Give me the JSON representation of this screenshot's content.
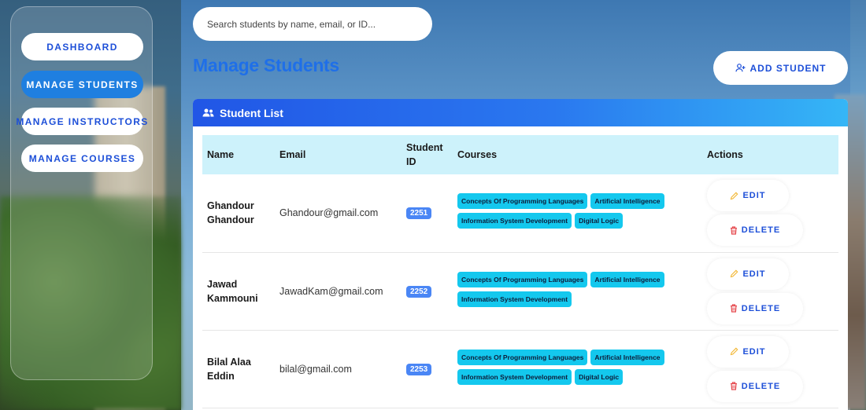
{
  "sidebar": {
    "items": [
      {
        "label": "DASHBOARD",
        "active": false
      },
      {
        "label": "MANAGE STUDENTS",
        "active": true
      },
      {
        "label": "MANAGE INSTRUCTORS",
        "active": false
      },
      {
        "label": "MANAGE COURSES",
        "active": false
      }
    ]
  },
  "search": {
    "placeholder": "Search students by name, email, or ID..."
  },
  "page": {
    "title": "Manage Students",
    "add_button_label": "ADD STUDENT"
  },
  "list": {
    "header": "Student List",
    "columns": [
      "Name",
      "Email",
      "Student ID",
      "Courses",
      "Actions"
    ],
    "edit_label": "EDIT",
    "delete_label": "DELETE",
    "rows": [
      {
        "name_line1": "Ghandour",
        "name_line2": "Ghandour",
        "email": "Ghandour@gmail.com",
        "id": "2251",
        "courses": [
          "Concepts Of Programming Languages",
          "Artificial Intelligence",
          "Information System Development",
          "Digital Logic"
        ]
      },
      {
        "name_line1": "Jawad",
        "name_line2": "Kammouni",
        "email": "JawadKam@gmail.com",
        "id": "2252",
        "courses": [
          "Concepts Of Programming Languages",
          "Artificial Intelligence",
          "Information System Development"
        ]
      },
      {
        "name_line1": "Bilal Alaa",
        "name_line2": "Eddin",
        "email": "bilal@gmail.com",
        "id": "2253",
        "courses": [
          "Concepts Of Programming Languages",
          "Artificial Intelligence",
          "Information System Development",
          "Digital Logic"
        ]
      }
    ]
  },
  "colors": {
    "accent": "#1f6fe8",
    "header_gradient_start": "#2156e6",
    "header_gradient_end": "#35b6f6",
    "course_badge": "#14c8ee",
    "id_badge": "#4a86f5",
    "table_head_bg": "#cdf2fb"
  },
  "icons": {
    "add": "user-plus-icon",
    "list": "users-icon",
    "edit": "pencil-icon",
    "delete": "trash-icon"
  }
}
